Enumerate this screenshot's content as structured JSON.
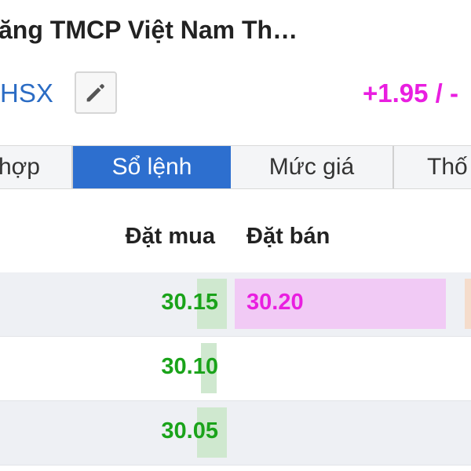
{
  "header": {
    "title": "ăng TMCP Việt Nam Th…",
    "exchange": "HSX",
    "change": "+1.95 / -"
  },
  "icons": {
    "edit": "pencil-icon"
  },
  "colors": {
    "accent": "#2d6fcf",
    "positive": "#1aa31a",
    "ceiling": "#e91ee0",
    "exchange_link": "#2b6cc4"
  },
  "tabs": [
    {
      "label": "hợp",
      "active": false
    },
    {
      "label": "Sổ lệnh",
      "active": true
    },
    {
      "label": "Mức giá",
      "active": false
    },
    {
      "label": "Thố",
      "active": false
    }
  ],
  "orderbook": {
    "columns": {
      "bid": "Đặt mua",
      "ask": "Đặt bán"
    },
    "rows": [
      {
        "bid": "30.15",
        "ask": "30.20"
      },
      {
        "bid": "30.10",
        "ask": ""
      },
      {
        "bid": "30.05",
        "ask": ""
      }
    ]
  }
}
